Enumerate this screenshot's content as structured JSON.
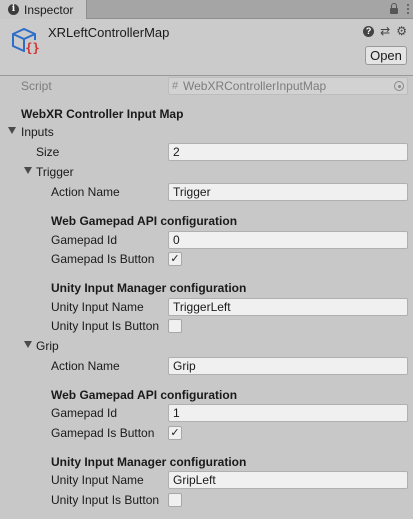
{
  "tab": {
    "label": "Inspector"
  },
  "header": {
    "title": "XRLeftControllerMap",
    "open_label": "Open"
  },
  "script": {
    "label": "Script",
    "value": "WebXRControllerInputMap"
  },
  "section_title": "WebXR Controller Input Map",
  "inputs": {
    "label": "Inputs",
    "size_label": "Size",
    "size_value": "2",
    "items": [
      {
        "name": "Trigger",
        "action_name_label": "Action Name",
        "action_name": "Trigger",
        "gamepad_header": "Web Gamepad API configuration",
        "gamepad_id_label": "Gamepad Id",
        "gamepad_id": "0",
        "gamepad_is_button_label": "Gamepad Is Button",
        "gamepad_is_button": "✓",
        "unity_header": "Unity Input Manager configuration",
        "unity_input_name_label": "Unity Input Name",
        "unity_input_name": "TriggerLeft",
        "unity_input_is_button_label": "Unity Input Is Button",
        "unity_input_is_button": ""
      },
      {
        "name": "Grip",
        "action_name_label": "Action Name",
        "action_name": "Grip",
        "gamepad_header": "Web Gamepad API configuration",
        "gamepad_id_label": "Gamepad Id",
        "gamepad_id": "1",
        "gamepad_is_button_label": "Gamepad Is Button",
        "gamepad_is_button": "✓",
        "unity_header": "Unity Input Manager configuration",
        "unity_input_name_label": "Unity Input Name",
        "unity_input_name": "GripLeft",
        "unity_input_is_button_label": "Unity Input Is Button",
        "unity_input_is_button": ""
      }
    ]
  },
  "icons": {
    "tab": "info-icon",
    "lock": "lock-icon",
    "menu": "kebab-menu-icon",
    "asset": "scriptable-object-icon",
    "help": "help-icon",
    "presets": "sliders-icon",
    "settings": "gear-icon"
  }
}
